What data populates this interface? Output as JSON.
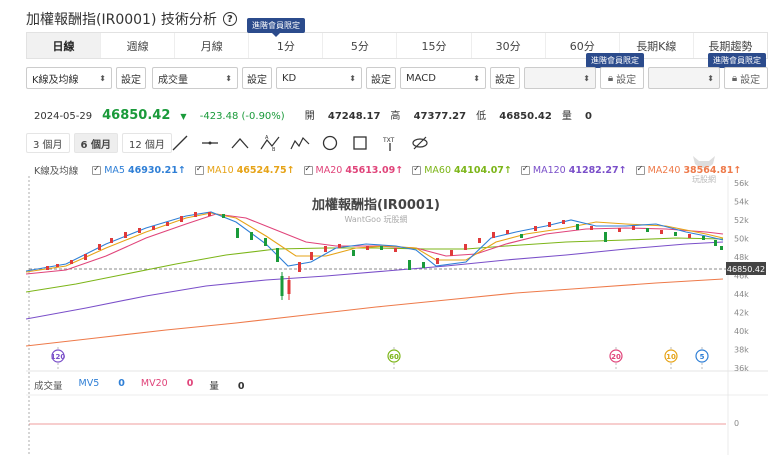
{
  "header": {
    "title": "加權報酬指(IR0001) 技術分析",
    "help": "?"
  },
  "tabs": [
    {
      "label": "日線",
      "active": true
    },
    {
      "label": "週線"
    },
    {
      "label": "月線"
    },
    {
      "label": "1分"
    },
    {
      "label": "5分"
    },
    {
      "label": "15分"
    },
    {
      "label": "30分"
    },
    {
      "label": "60分"
    },
    {
      "label": "長期K線"
    },
    {
      "label": "長期趨勢"
    }
  ],
  "member_badge": "進階會員限定",
  "selectors": {
    "main": "K線及均線",
    "vol": "成交量",
    "ind1": "KD",
    "ind2": "MACD",
    "set": "設定"
  },
  "quote": {
    "date": "2024-05-29",
    "price": "46850.42",
    "change": "-423.48 (-0.90%)",
    "open_label": "開",
    "open": "47248.17",
    "high_label": "高",
    "high": "47377.27",
    "low_label": "低",
    "low": "46850.42",
    "vol_label": "量",
    "vol": "0"
  },
  "periods": [
    {
      "label": "3 個月"
    },
    {
      "label": "6 個月",
      "active": true
    },
    {
      "label": "12 個月"
    }
  ],
  "legend": {
    "label": "K線及均線",
    "items": [
      {
        "name": "MA5",
        "value": "46930.21↑",
        "color": "#2f7fd6"
      },
      {
        "name": "MA10",
        "value": "46524.75↑",
        "color": "#e6a317"
      },
      {
        "name": "MA20",
        "value": "45613.09↑",
        "color": "#e0447a"
      },
      {
        "name": "MA60",
        "value": "44104.07↑",
        "color": "#7cb518"
      },
      {
        "name": "MA120",
        "value": "41282.27↑",
        "color": "#7a4fc9"
      },
      {
        "name": "MA240",
        "value": "38564.81↑",
        "color": "#ee7a4a"
      }
    ]
  },
  "watermark": "玩股網",
  "chart": {
    "title": "加權報酬指(IR0001)",
    "subtitle": "WantGoo 玩股網",
    "yticks": [
      "56k",
      "54k",
      "52k",
      "50k",
      "48k",
      "46k",
      "44k",
      "42k",
      "40k",
      "38k",
      "36k"
    ],
    "current_label": "46850.42",
    "markers": [
      {
        "label": "120",
        "color": "#7a4fc9"
      },
      {
        "label": "60",
        "color": "#7cb518"
      },
      {
        "label": "20",
        "color": "#e0447a"
      },
      {
        "label": "10",
        "color": "#e6a317"
      },
      {
        "label": "5",
        "color": "#2f7fd6"
      }
    ],
    "vol_zero": "0"
  },
  "volume": {
    "label": "成交量",
    "mv5_label": "MV5",
    "mv5": "0",
    "mv20_label": "MV20",
    "mv20": "0",
    "vol_label": "量",
    "vol": "0"
  }
}
